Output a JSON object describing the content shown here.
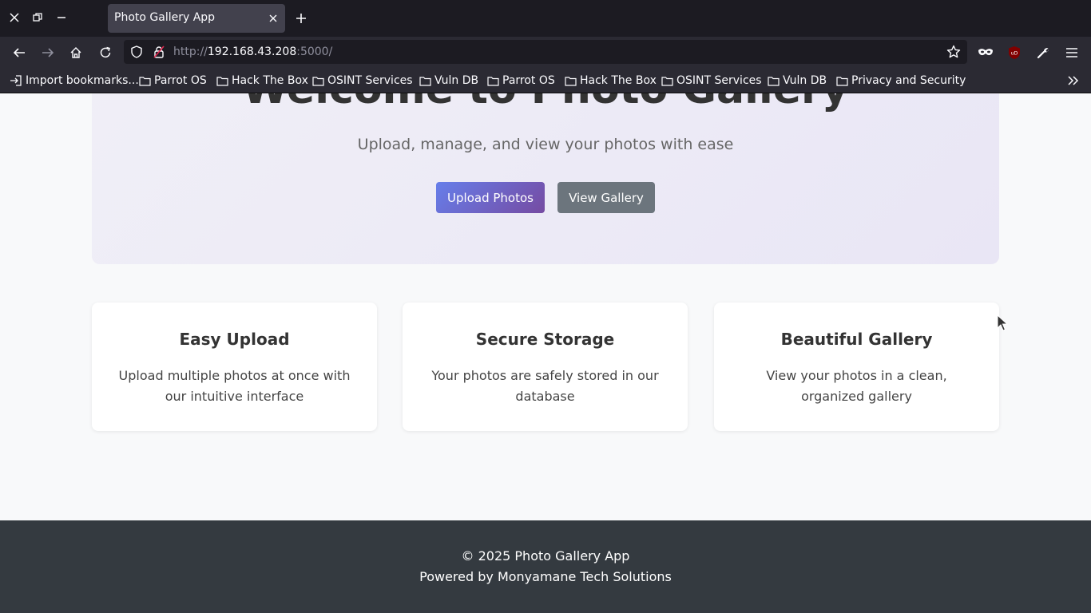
{
  "browser": {
    "tab_title": "Photo Gallery App",
    "url_scheme": "http://",
    "url_host": "192.168.43.208",
    "url_rest": ":5000/",
    "bookmarks": [
      "Import bookmarks...",
      "Parrot OS",
      "Hack The Box",
      "OSINT Services",
      "Vuln DB",
      "Parrot OS",
      "Hack The Box",
      "OSINT Services",
      "Vuln DB",
      "Privacy and Security"
    ]
  },
  "hero": {
    "title": "Welcome to Photo Gallery",
    "subtitle": "Upload, manage, and view your photos with ease",
    "upload_button": "Upload Photos",
    "view_button": "View Gallery"
  },
  "features": [
    {
      "title": "Easy Upload",
      "text": "Upload multiple photos at once with our intuitive interface"
    },
    {
      "title": "Secure Storage",
      "text": "Your photos are safely stored in our database"
    },
    {
      "title": "Beautiful Gallery",
      "text": "View your photos in a clean, organized gallery"
    }
  ],
  "footer": {
    "copyright": "© 2025 Photo Gallery App",
    "powered_by": "Powered by Monyamane Tech Solutions"
  },
  "colors": {
    "accent_gradient_start": "#667eea",
    "accent_gradient_end": "#764ba2",
    "secondary_button": "#6c757d",
    "footer_bg": "#343a40"
  }
}
